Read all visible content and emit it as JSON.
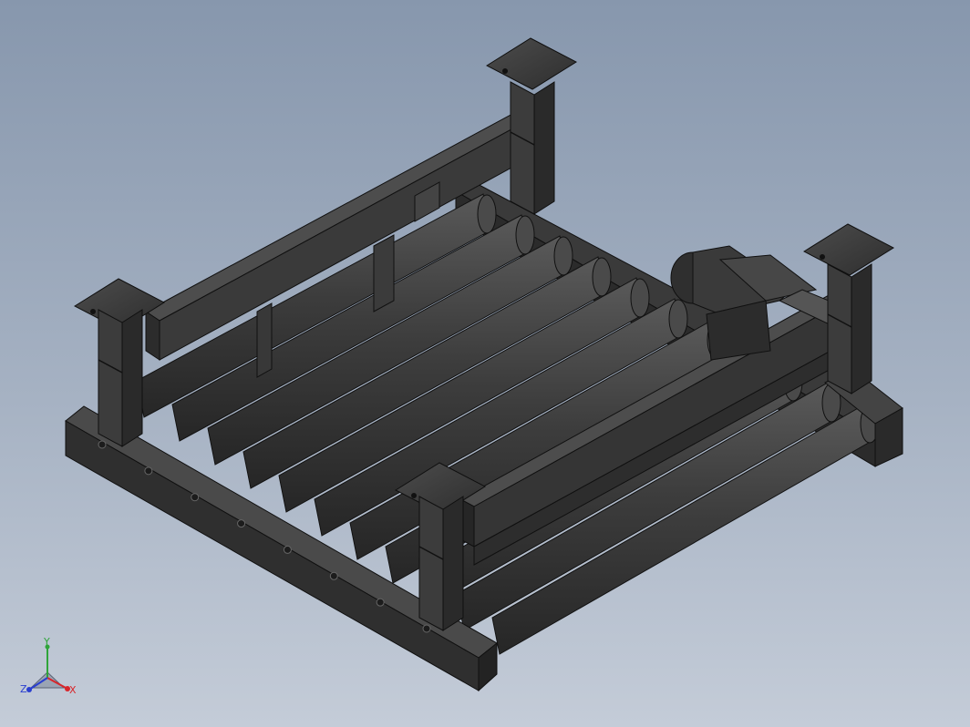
{
  "viewport": {
    "background_top": "#8797ad",
    "background_bottom": "#c4ccd8",
    "part_color": "#3f3f3f",
    "part_edge_color": "#0f0f0f"
  },
  "model": {
    "type": "roller-conveyor-frame",
    "roller_count": 11,
    "leg_count": 4,
    "has_drive_motor": true
  },
  "triad": {
    "x_label": "X",
    "y_label": "Y",
    "z_label": "Z",
    "x_color": "#d8262b",
    "y_color": "#2fa43a",
    "z_color": "#2a3fcf"
  }
}
